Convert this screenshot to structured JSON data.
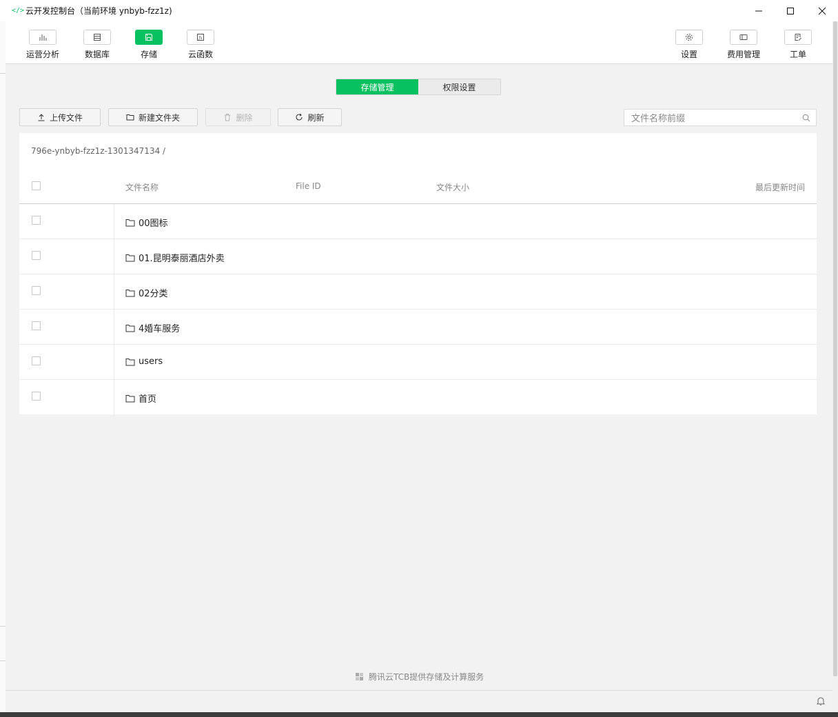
{
  "window": {
    "title": "云开发控制台（当前环境 ynbyb-fzz1z)",
    "app_icon": "</>",
    "controls": [
      "minimize-icon",
      "maximize-icon",
      "close-icon"
    ]
  },
  "toolbar": {
    "left": [
      {
        "label": "运营分析",
        "icon": "bar-chart-icon",
        "active": false
      },
      {
        "label": "数据库",
        "icon": "database-icon",
        "active": false
      },
      {
        "label": "存储",
        "icon": "storage-icon",
        "active": true
      },
      {
        "label": "云函数",
        "icon": "function-icon",
        "active": false
      }
    ],
    "right": [
      {
        "label": "设置",
        "icon": "gear-icon"
      },
      {
        "label": "费用管理",
        "icon": "billing-icon"
      },
      {
        "label": "工单",
        "icon": "ticket-icon"
      }
    ]
  },
  "tabs": [
    {
      "label": "存储管理",
      "active": true
    },
    {
      "label": "权限设置",
      "active": false
    }
  ],
  "actions": {
    "upload": "上传文件",
    "new_folder": "新建文件夹",
    "delete": "删除",
    "refresh": "刷新"
  },
  "search": {
    "placeholder": "文件名称前缀"
  },
  "breadcrumb": "796e-ynbyb-fzz1z-1301347134 /",
  "table": {
    "columns": [
      "文件名称",
      "File ID",
      "文件大小",
      "最后更新时间"
    ],
    "rows": [
      {
        "name": "00图标"
      },
      {
        "name": "01.昆明泰丽酒店外卖"
      },
      {
        "name": "02分类"
      },
      {
        "name": "4婚车服务"
      },
      {
        "name": "users"
      },
      {
        "name": "首页"
      }
    ]
  },
  "footer": {
    "note": "腾讯云TCB提供存储及计算服务"
  },
  "colors": {
    "accent": "#07c160",
    "background": "#f2f2f2"
  }
}
